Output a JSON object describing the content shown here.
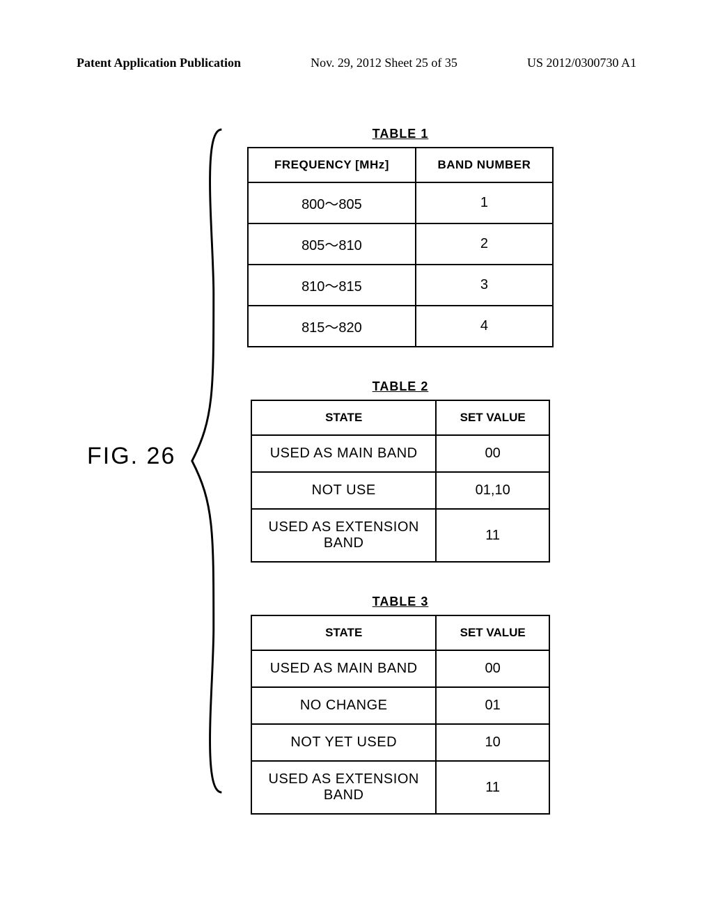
{
  "header": {
    "left": "Patent Application Publication",
    "mid": "Nov. 29, 2012  Sheet 25 of 35",
    "right": "US 2012/0300730 A1"
  },
  "figure_label": "FIG. 26",
  "tables": {
    "t1": {
      "title": "TABLE 1",
      "headers": [
        "FREQUENCY [MHz]",
        "BAND NUMBER"
      ],
      "rows": [
        {
          "c1": "800～805",
          "c2": "1"
        },
        {
          "c1": "805～810",
          "c2": "2"
        },
        {
          "c1": "810～815",
          "c2": "3"
        },
        {
          "c1": "815～820",
          "c2": "4"
        }
      ]
    },
    "t2": {
      "title": "TABLE 2",
      "headers": [
        "STATE",
        "SET VALUE"
      ],
      "rows": [
        {
          "c1": "USED AS MAIN BAND",
          "c2": "00"
        },
        {
          "c1": "NOT USE",
          "c2": "01,10"
        },
        {
          "c1": "USED AS EXTENSION BAND",
          "c2": "11"
        }
      ]
    },
    "t3": {
      "title": "TABLE 3",
      "headers": [
        "STATE",
        "SET VALUE"
      ],
      "rows": [
        {
          "c1": "USED AS MAIN BAND",
          "c2": "00"
        },
        {
          "c1": "NO CHANGE",
          "c2": "01"
        },
        {
          "c1": "NOT YET USED",
          "c2": "10"
        },
        {
          "c1": "USED AS EXTENSION BAND",
          "c2": "11"
        }
      ]
    }
  },
  "chart_data": [
    {
      "type": "table",
      "title": "TABLE 1",
      "columns": [
        "FREQUENCY [MHz]",
        "BAND NUMBER"
      ],
      "rows": [
        [
          "800～805",
          1
        ],
        [
          "805～810",
          2
        ],
        [
          "810～815",
          3
        ],
        [
          "815～820",
          4
        ]
      ]
    },
    {
      "type": "table",
      "title": "TABLE 2",
      "columns": [
        "STATE",
        "SET VALUE"
      ],
      "rows": [
        [
          "USED AS MAIN BAND",
          "00"
        ],
        [
          "NOT USE",
          "01,10"
        ],
        [
          "USED AS EXTENSION BAND",
          "11"
        ]
      ]
    },
    {
      "type": "table",
      "title": "TABLE 3",
      "columns": [
        "STATE",
        "SET VALUE"
      ],
      "rows": [
        [
          "USED AS MAIN BAND",
          "00"
        ],
        [
          "NO CHANGE",
          "01"
        ],
        [
          "NOT YET USED",
          "10"
        ],
        [
          "USED AS EXTENSION BAND",
          "11"
        ]
      ]
    }
  ]
}
